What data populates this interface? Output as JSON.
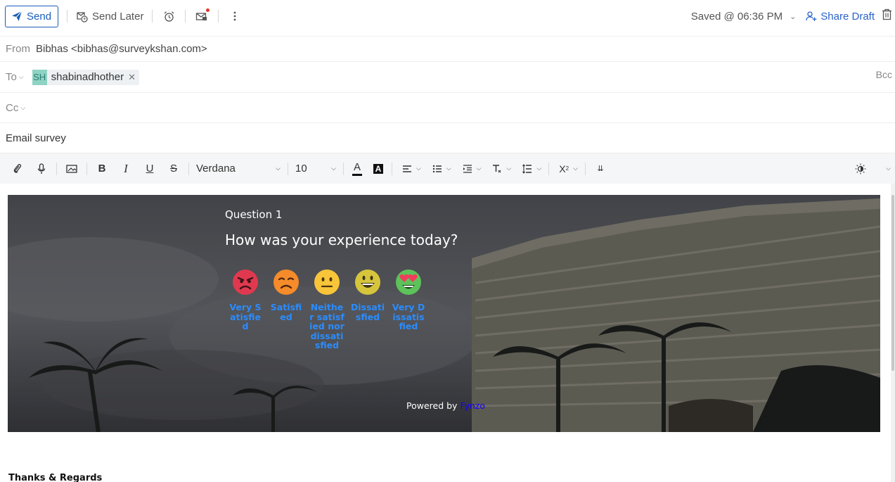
{
  "toolbar": {
    "send_label": "Send",
    "send_later_label": "Send Later",
    "saved_status": "Saved @ 06:36 PM",
    "share_draft_label": "Share Draft"
  },
  "header": {
    "from_label": "From",
    "from_value": "Bibhas <bibhas@surveykshan.com>",
    "to_label": "To",
    "recipient_initials": "SH",
    "recipient_name": "shabinadhother",
    "bcc_label": "Bcc",
    "cc_label": "Cc",
    "subject": "Email survey"
  },
  "format_toolbar": {
    "font_family": "Verdana",
    "font_size": "10"
  },
  "survey": {
    "question_number": "Question 1",
    "question_text": "How was your experience today?",
    "options": [
      {
        "label": "Very Satisfied",
        "icon": "angry-face-icon",
        "color": "#e8384f"
      },
      {
        "label": "Satisfied",
        "icon": "frowning-face-icon",
        "color": "#f58b2a"
      },
      {
        "label": "Neither satisfied nor dissatisfied",
        "icon": "neutral-face-icon",
        "color": "#f8c33a"
      },
      {
        "label": "Dissatisfied",
        "icon": "smiling-face-icon",
        "color": "#d6c53c"
      },
      {
        "label": "Very Dissatisfied",
        "icon": "heart-eyes-face-icon",
        "color": "#5dc25a"
      }
    ],
    "powered_by_prefix": "Powered by",
    "powered_by_brand": "Fynzo"
  },
  "signature": {
    "regards": "Thanks & Regards"
  },
  "colors": {
    "accent": "#1a5cb8",
    "link": "#2a62c9",
    "option_label": "#2a8cff"
  }
}
